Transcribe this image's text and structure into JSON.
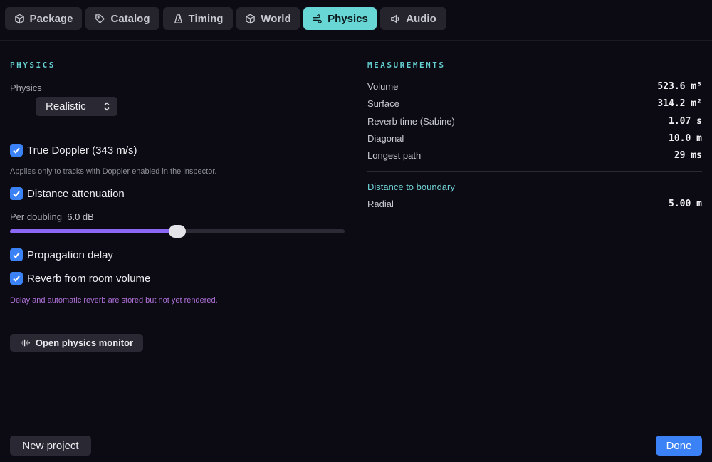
{
  "tabs": [
    {
      "label": "Package",
      "icon": "package-icon"
    },
    {
      "label": "Catalog",
      "icon": "tag-icon"
    },
    {
      "label": "Timing",
      "icon": "metronome-icon"
    },
    {
      "label": "World",
      "icon": "cube-icon"
    },
    {
      "label": "Physics",
      "icon": "wind-icon",
      "active": true
    },
    {
      "label": "Audio",
      "icon": "speaker-icon"
    }
  ],
  "physics": {
    "section_title": "PHYSICS",
    "mode_label": "Physics",
    "mode_value": "Realistic",
    "true_doppler": {
      "label": "True Doppler (343 m/s)",
      "checked": true
    },
    "doppler_hint": "Applies only to tracks with Doppler enabled in the inspector.",
    "distance_attenuation": {
      "label": "Distance attenuation",
      "checked": true
    },
    "per_doubling": {
      "label": "Per doubling",
      "value": "6.0 dB",
      "fraction": 0.5
    },
    "propagation_delay": {
      "label": "Propagation delay",
      "checked": true
    },
    "reverb_room": {
      "label": "Reverb from room volume",
      "checked": true
    },
    "delay_hint": "Delay and automatic reverb are stored but not yet rendered.",
    "monitor_button": "Open physics monitor"
  },
  "measurements": {
    "section_title": "MEASUREMENTS",
    "rows": [
      {
        "label": "Volume",
        "value": "523.6 m³"
      },
      {
        "label": "Surface",
        "value": "314.2 m²"
      },
      {
        "label": "Reverb time (Sabine)",
        "value": "1.07 s"
      },
      {
        "label": "Diagonal",
        "value": "10.0 m"
      },
      {
        "label": "Longest path",
        "value": "29 ms"
      }
    ],
    "boundary_title": "Distance to boundary",
    "boundary_rows": [
      {
        "label": "Radial",
        "value": "5.00 m"
      }
    ]
  },
  "footer": {
    "new_project": "New project",
    "done": "Done"
  },
  "colors": {
    "accent": "#69d6d6",
    "checkbox": "#3a82f6",
    "slider": "#8b67f5",
    "done_button": "#3a82f6",
    "warning_hint": "#b072d9"
  }
}
